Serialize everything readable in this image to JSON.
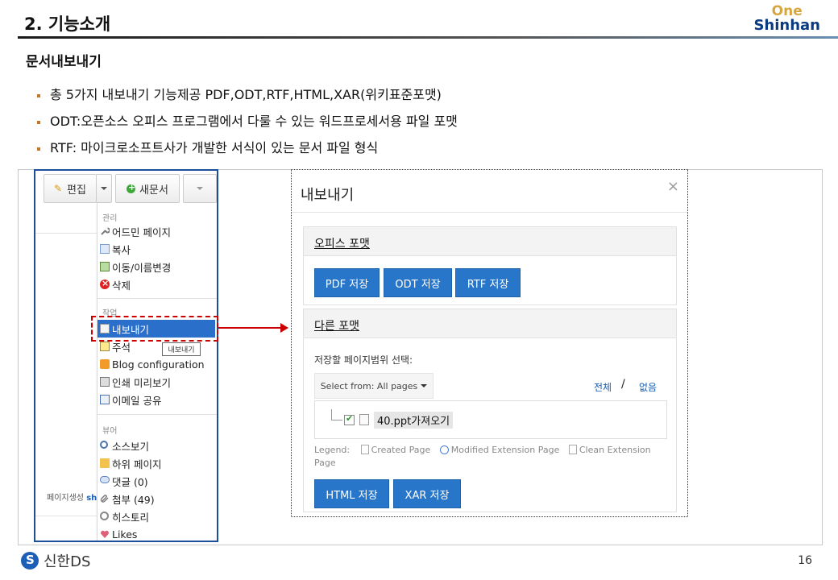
{
  "slide": {
    "title": "2. 기능소개",
    "brand_one": "One",
    "brand_shinhan": "Shinhan",
    "section_title": "문서내보내기",
    "bullets": [
      "총 5가지 내보내기 기능제공 PDF,ODT,RTF,HTML,XAR(위키표준포맷)",
      "ODT:오픈소스 오피스 프로그램에서 다룰 수 있는 워드프로세서용 파일 포맷",
      "RTF: 마이크로소프트사가 개발한 서식이 있는 문서 파일 형식"
    ],
    "page_number": "16",
    "footer_logo": "신한DS"
  },
  "toolbar": {
    "edit_label": "편집",
    "new_doc_label": "새문서"
  },
  "left_page": {
    "page_created_prefix": "페이지생성",
    "page_created_link": "sh"
  },
  "menu": {
    "group_manage": "관리",
    "admin_page": "어드민 페이지",
    "copy": "복사",
    "move_rename": "이동/이름변경",
    "delete": "삭제",
    "group_work": "작업",
    "export": "내보내기",
    "annotation": "주석",
    "blog_config": "Blog configuration",
    "print_preview": "인쇄 미리보기",
    "email_share": "이메일 공유",
    "group_view": "뷰어",
    "view_source": "소스보기",
    "child_pages": "하위 페이지",
    "comments": "댓글 (0)",
    "attachments": "첨부 (49)",
    "history": "히스토리",
    "likes": "Likes",
    "tooltip": "내보내기"
  },
  "dialog": {
    "title": "내보내기",
    "close": "×",
    "office_format": "오피스 포맷",
    "pdf_btn": "PDF 저장",
    "odt_btn": "ODT 저장",
    "rtf_btn": "RTF 저장",
    "other_format": "다른 포맷",
    "range_label": "저장할 페이지범위 선택:",
    "select_label": "Select from: All pages",
    "all_link": "전체",
    "slash": "/",
    "none_link": "없음",
    "tree_item": "40.ppt가져오기",
    "legend_label": "Legend:",
    "legend_created": "Created Page",
    "legend_modified": "Modified Extension Page",
    "legend_clean": "Clean Extension Page",
    "html_btn": "HTML 저장",
    "xar_btn": "XAR 저장"
  },
  "colors": {
    "accent_blue": "#2876c9",
    "highlight_red": "#cc0000",
    "bullet_orange": "#c8761d",
    "brand_navy": "#0a3a82",
    "brand_gold": "#d8a640"
  }
}
